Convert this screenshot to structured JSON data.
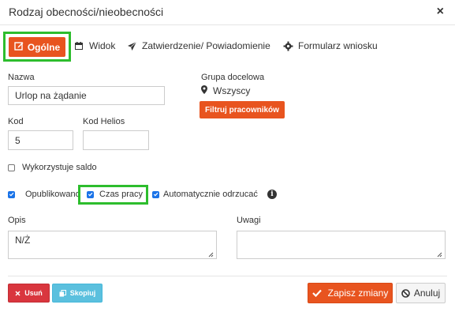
{
  "dialog": {
    "title": "Rodzaj obecności/nieobecności",
    "close_label": "×"
  },
  "tabs": [
    {
      "label": "Ogólne",
      "icon": "edit-icon",
      "active": true
    },
    {
      "label": "Widok",
      "icon": "calendar-icon",
      "active": false
    },
    {
      "label": "Zatwierdzenie/ Powiadomienie",
      "icon": "send-icon",
      "active": false
    },
    {
      "label": "Formularz wniosku",
      "icon": "gear-icon",
      "active": false
    }
  ],
  "form": {
    "name": {
      "label": "Nazwa",
      "value": "Urlop na żądanie"
    },
    "code": {
      "label": "Kod",
      "value": "5"
    },
    "helios_code": {
      "label": "Kod Helios",
      "value": ""
    },
    "target_group": {
      "label": "Grupa docelowa",
      "value": "Wszyscy",
      "filter_button": "Filtruj pracowników"
    },
    "uses_balance": {
      "label": "Wykorzystuje saldo",
      "checked": false
    },
    "published": {
      "label": "Opublikowano",
      "checked": true
    },
    "work_time": {
      "label": "Czas pracy",
      "checked": true
    },
    "auto_reject": {
      "label": "Automatycznie odrzucać",
      "checked": true,
      "info_icon": "i"
    },
    "description": {
      "label": "Opis",
      "value": "N/Ż"
    },
    "notes": {
      "label": "Uwagi",
      "value": ""
    }
  },
  "footer": {
    "delete_label": "Usuń",
    "copy_label": "Skopiuj",
    "save_label": "Zapisz zmiany",
    "cancel_label": "Anuluj"
  },
  "colors": {
    "accent": "#e8541f",
    "highlight": "#2dbd2d",
    "danger": "#d9363e",
    "info": "#5bc0de"
  }
}
